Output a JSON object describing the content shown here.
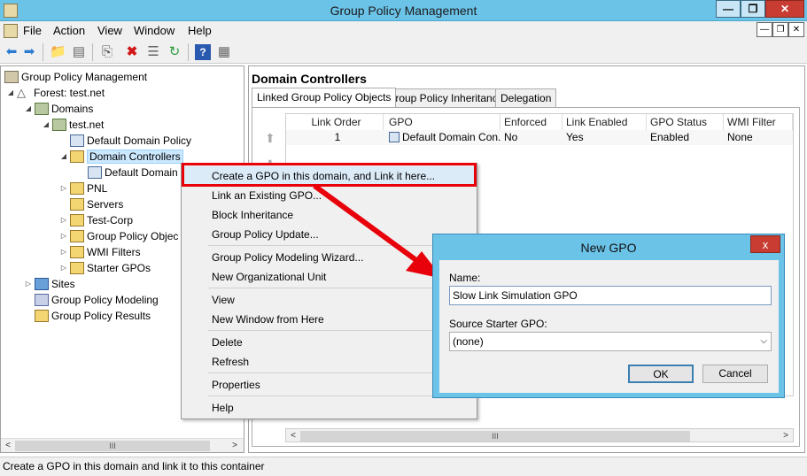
{
  "window": {
    "title": "Group Policy Management",
    "min": "—",
    "max": "❐",
    "close": "✕"
  },
  "menubar": {
    "items": [
      "File",
      "Action",
      "View",
      "Window",
      "Help"
    ],
    "mdi": [
      "—",
      "❐",
      "✕"
    ]
  },
  "tree": {
    "root": "Group Policy Management",
    "forest": "Forest: test.net",
    "domains": "Domains",
    "domain": "test.net",
    "default_domain_policy": "Default Domain Policy",
    "domain_controllers": "Domain Controllers",
    "default_domain_child": "Default Domain",
    "pnl": "PNL",
    "servers": "Servers",
    "test_corp": "Test-Corp",
    "gpo_objects": "Group Policy Objec",
    "wmi_filters": "WMI Filters",
    "starter_gpos": "Starter GPOs",
    "sites": "Sites",
    "modeling": "Group Policy Modeling",
    "results": "Group Policy Results"
  },
  "scroll": {
    "left": "<",
    "thumb": "III",
    "right": ">"
  },
  "right": {
    "title": "Domain Controllers",
    "tabs": [
      "Linked Group Policy Objects",
      "Group Policy Inheritance",
      "Delegation"
    ],
    "columns": [
      "Link Order",
      "GPO",
      "Enforced",
      "Link Enabled",
      "GPO Status",
      "WMI Filter"
    ],
    "row": {
      "link_order": "1",
      "gpo": "Default Domain Con...",
      "enforced": "No",
      "link_enabled": "Yes",
      "gpo_status": "Enabled",
      "wmi_filter": "None"
    }
  },
  "context_menu": {
    "create_gpo": "Create a GPO in this domain, and Link it here...",
    "link_existing": "Link an Existing GPO...",
    "block_inheritance": "Block Inheritance",
    "gp_update": "Group Policy Update...",
    "modeling_wizard": "Group Policy Modeling Wizard...",
    "new_ou": "New Organizational Unit",
    "view": "View",
    "new_window": "New Window from Here",
    "delete": "Delete",
    "refresh": "Refresh",
    "properties": "Properties",
    "help": "Help"
  },
  "dialog": {
    "title": "New GPO",
    "close": "x",
    "name_label": "Name:",
    "name_value": "Slow Link Simulation GPO",
    "starter_label": "Source Starter GPO:",
    "starter_value": "(none)",
    "ok": "OK",
    "cancel": "Cancel"
  },
  "status": "Create a GPO in this domain and link it to this container",
  "colors": {
    "titlebar": "#6cc3e8",
    "close": "#c83c32",
    "highlight": "#e8000b",
    "selection": "#cce8ff"
  }
}
